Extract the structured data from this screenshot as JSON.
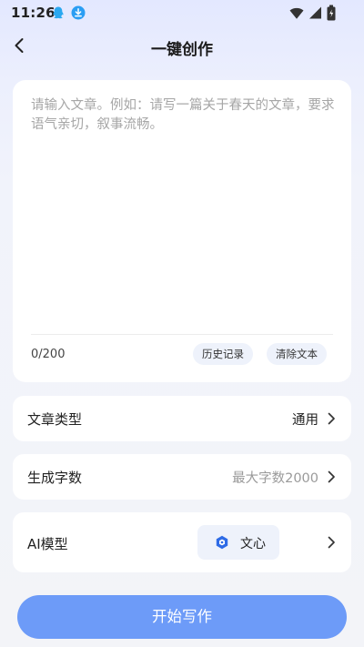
{
  "status_bar": {
    "time": "11:26",
    "icons": [
      "qq-icon",
      "download-icon",
      "wifi-icon",
      "signal-icon",
      "battery-icon"
    ]
  },
  "header": {
    "title": "一键创作",
    "back_icon": "chevron-left-icon"
  },
  "editor": {
    "placeholder": "请输入文章。例如：请写一篇关于春天的文章，要求语气亲切，叙事流畅。",
    "value": "",
    "char_count": "0/200",
    "history_button": "历史记录",
    "clear_button": "清除文本"
  },
  "settings": {
    "article_type": {
      "label": "文章类型",
      "value": "通用"
    },
    "word_count": {
      "label": "生成字数",
      "value": "最大字数2000"
    },
    "ai_model": {
      "label": "AI模型",
      "value": "文心"
    }
  },
  "start_button": "开始写作",
  "colors": {
    "accent": "#6d9bf8",
    "chip_bg": "#eef2fb",
    "qq_blue": "#2aa8f0",
    "download_blue": "#2b9ef3",
    "model_logo_blue": "#2e6be6"
  }
}
